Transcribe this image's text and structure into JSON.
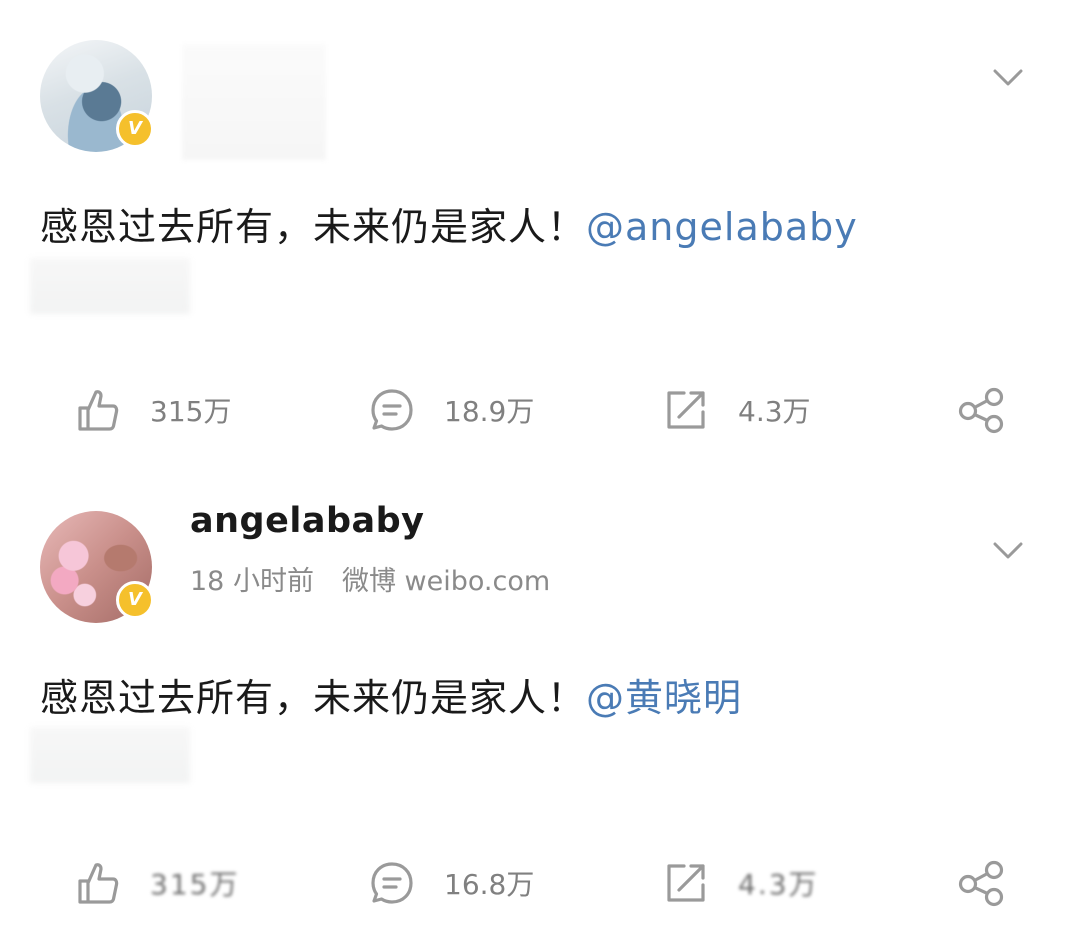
{
  "posts": [
    {
      "username": "",
      "avatar_icon": "avatar-portrait-man",
      "verified_badge": "V",
      "text": "感恩过去所有，未来仍是家人！",
      "mention": "@angelababy",
      "actions": {
        "like_count": "315万",
        "comment_count": "18.9万",
        "repost_count": "4.3万"
      }
    },
    {
      "username": "angelababy",
      "avatar_icon": "avatar-portrait-woman",
      "verified_badge": "V",
      "time": "18 小时前",
      "source": "微博 weibo.com",
      "text": "感恩过去所有，未来仍是家人！",
      "mention": "@黄晓明",
      "actions": {
        "like_count": "315万",
        "comment_count": "16.8万",
        "repost_count": "4.3万"
      }
    }
  ],
  "colors": {
    "mention": "#4a7bb5",
    "verified_badge": "#f5c02c",
    "muted_text": "#808080",
    "icon": "#9a9a9a"
  }
}
